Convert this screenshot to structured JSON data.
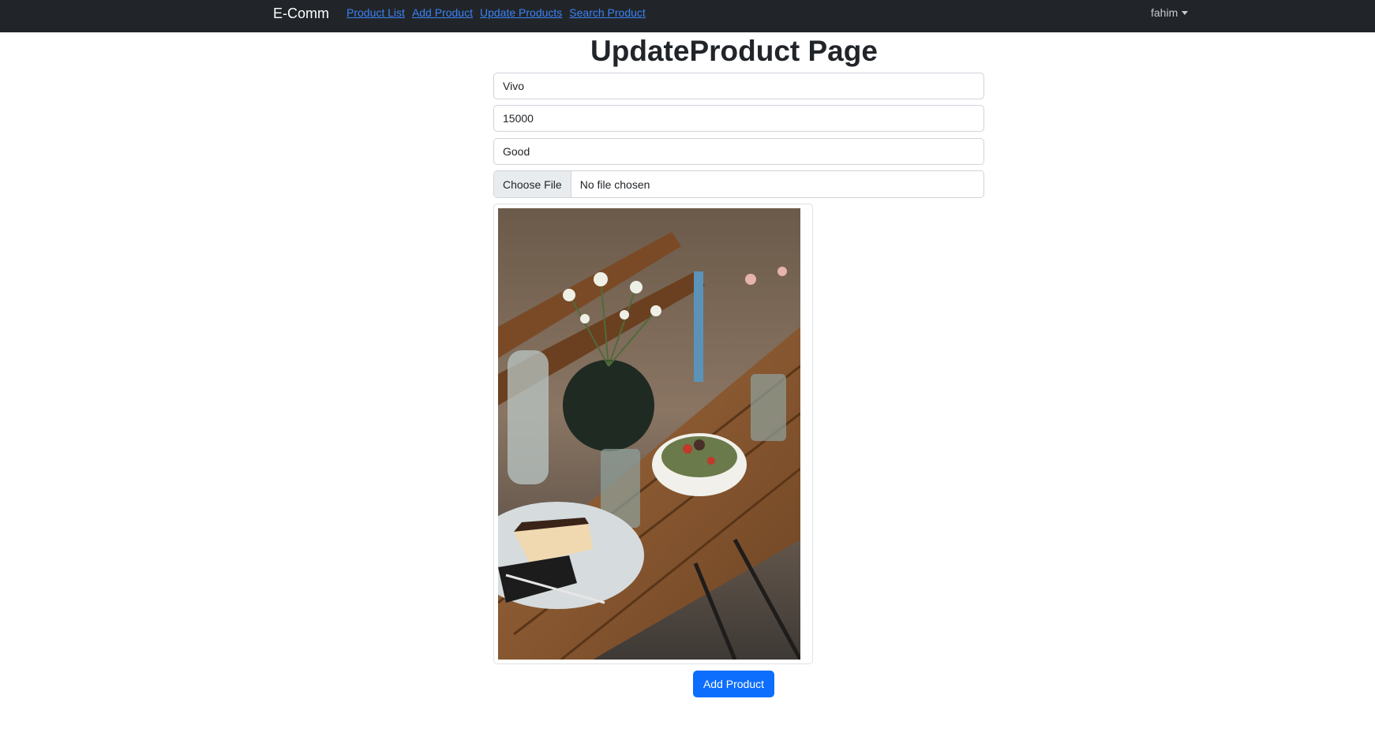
{
  "navbar": {
    "brand": "E-Comm",
    "links": [
      {
        "label": "Product List"
      },
      {
        "label": "Add Product"
      },
      {
        "label": "Update Products"
      },
      {
        "label": "Search Product"
      }
    ],
    "user": "fahim"
  },
  "page": {
    "title": "UpdateProduct Page"
  },
  "form": {
    "name_value": "Vivo",
    "price_value": "15000",
    "description_value": "Good",
    "file_button_label": "Choose File",
    "file_status": "No file chosen",
    "submit_label": "Add Product"
  },
  "image": {
    "subject": "table-setting-photo"
  },
  "colors": {
    "navbar_bg": "#212529",
    "link": "#3b82f6",
    "primary_button": "#0d6efd"
  }
}
